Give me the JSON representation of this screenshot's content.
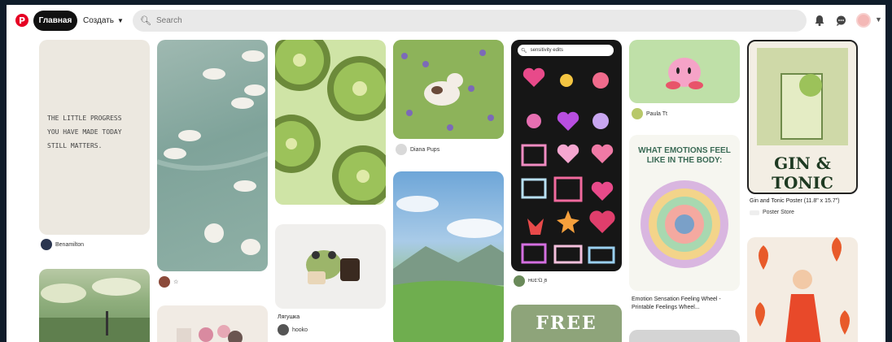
{
  "nav": {
    "logo": "P",
    "home": "Главная",
    "create": "Создать",
    "search_placeholder": "Search"
  },
  "pins": {
    "note": {
      "text": "THE LITTLE PROGRESS\nYOU HAVE MADE TODAY\nSTILL MATTERS.",
      "author": "Benamilton"
    },
    "ducks": {
      "author": "☆"
    },
    "frog": {
      "caption": "Лягушка",
      "author": "hooko"
    },
    "cow": {
      "author": "Diana Pups"
    },
    "emoji": {
      "search": "sensitivity edits",
      "author": "ʜᴜɪ:ଘ ̯ɞ"
    },
    "kirby": {
      "author": "Paula Tt"
    },
    "emotions": {
      "title": "WHAT EMOTIONS FEEL LIKE IN THE BODY:",
      "caption": "Emotion Sensation Feeling Wheel - Printable Feelings Wheel..."
    },
    "gin": {
      "title": "GIN & TONIC",
      "caption": "Gin and Tonic Poster (11.8\" x 15.7\")",
      "author": "Poster Store"
    },
    "free": {
      "title": "FREE"
    }
  }
}
